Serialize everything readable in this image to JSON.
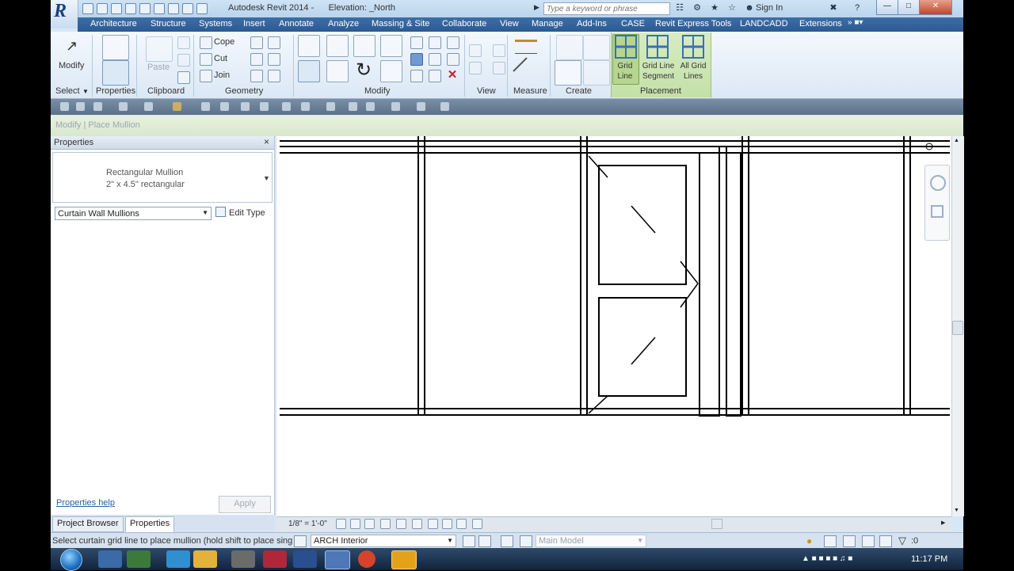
{
  "window": {
    "app_title": "Autodesk Revit 2014 -",
    "view_title": "Elevation: _North",
    "search_placeholder": "Type a keyword or phrase",
    "sign_in": "Sign In"
  },
  "ribbon_tabs": [
    "Architecture",
    "Structure",
    "Systems",
    "Insert",
    "Annotate",
    "Analyze",
    "Massing & Site",
    "Collaborate",
    "View",
    "Manage",
    "Add-Ins",
    "CASE",
    "Revit Express Tools",
    "LANDCADD",
    "Extensions"
  ],
  "ribbon": {
    "modify_label": "Modify",
    "panels": {
      "select": "Select",
      "properties": "Properties",
      "clipboard": "Clipboard",
      "geometry": "Geometry",
      "modify": "Modify",
      "view": "View",
      "measure": "Measure",
      "create": "Create",
      "placement": "Placement"
    },
    "clipboard": {
      "paste": "Paste"
    },
    "geometry": {
      "cope": "Cope",
      "cut": "Cut",
      "join": "Join"
    },
    "placement": {
      "grid_line": [
        "Grid",
        "Line"
      ],
      "grid_line_segment": [
        "Grid Line",
        "Segment"
      ],
      "all_grid_lines": [
        "All Grid",
        "Lines"
      ]
    }
  },
  "context_label": "Modify | Place Mullion",
  "properties": {
    "title": "Properties",
    "close": "×",
    "type_name": "Rectangular Mullion",
    "type_size": "2\" x 4.5\" rectangular",
    "filter": "Curtain Wall Mullions",
    "edit_type": "Edit Type",
    "help_link": "Properties help",
    "apply": "Apply"
  },
  "browser_tabs": {
    "project_browser": "Project Browser",
    "properties": "Properties"
  },
  "view_control": {
    "scale": "1/8\" = 1'-0\""
  },
  "status": {
    "message": "Select curtain grid line to place mullion (hold shift to place sing",
    "workset": "ARCH Interior",
    "design_option": "Main Model",
    "filter_count": ":0"
  },
  "taskbar": {
    "time": "11:17 PM"
  },
  "colors": {
    "tab_bar": "#2b5a92",
    "placement_panel": "#c4e0a8",
    "close_button": "#c2452b",
    "taskbar": "#10243c"
  },
  "icons": [
    "revit-logo-icon",
    "search-icon",
    "help-icon",
    "modify-cursor-icon",
    "type-properties-icon",
    "paste-icon",
    "cope-icon",
    "cut-icon",
    "join-icon",
    "align-icon",
    "move-icon",
    "rotate-icon",
    "delete-icon",
    "measure-icon",
    "grid-line-icon",
    "start-orb-icon",
    "filter-icon"
  ]
}
